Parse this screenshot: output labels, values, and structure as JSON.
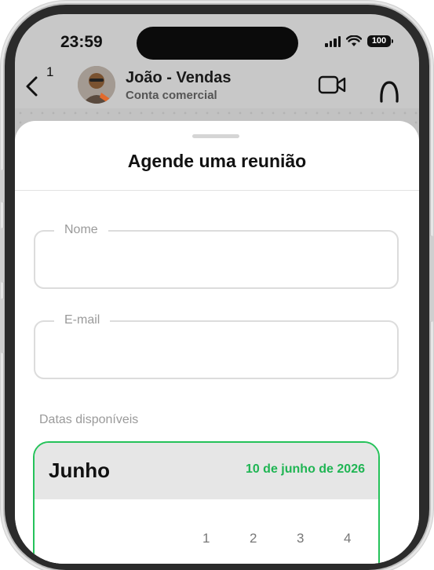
{
  "status_bar": {
    "time": "23:59",
    "battery": "100"
  },
  "header": {
    "back_count": "1",
    "contact_name": "João - Vendas",
    "contact_subtitle": "Conta comercial"
  },
  "sheet": {
    "title": "Agende uma reunião",
    "name_field": {
      "label": "Nome",
      "value": ""
    },
    "email_field": {
      "label": "E-mail",
      "value": ""
    },
    "dates_label": "Datas disponíveis",
    "calendar": {
      "month": "Junho",
      "selected_date": "10 de junho de 2026",
      "days": [
        "1",
        "2",
        "3",
        "4"
      ]
    }
  },
  "colors": {
    "accent": "#25c25a",
    "accent_text": "#1fb553"
  }
}
